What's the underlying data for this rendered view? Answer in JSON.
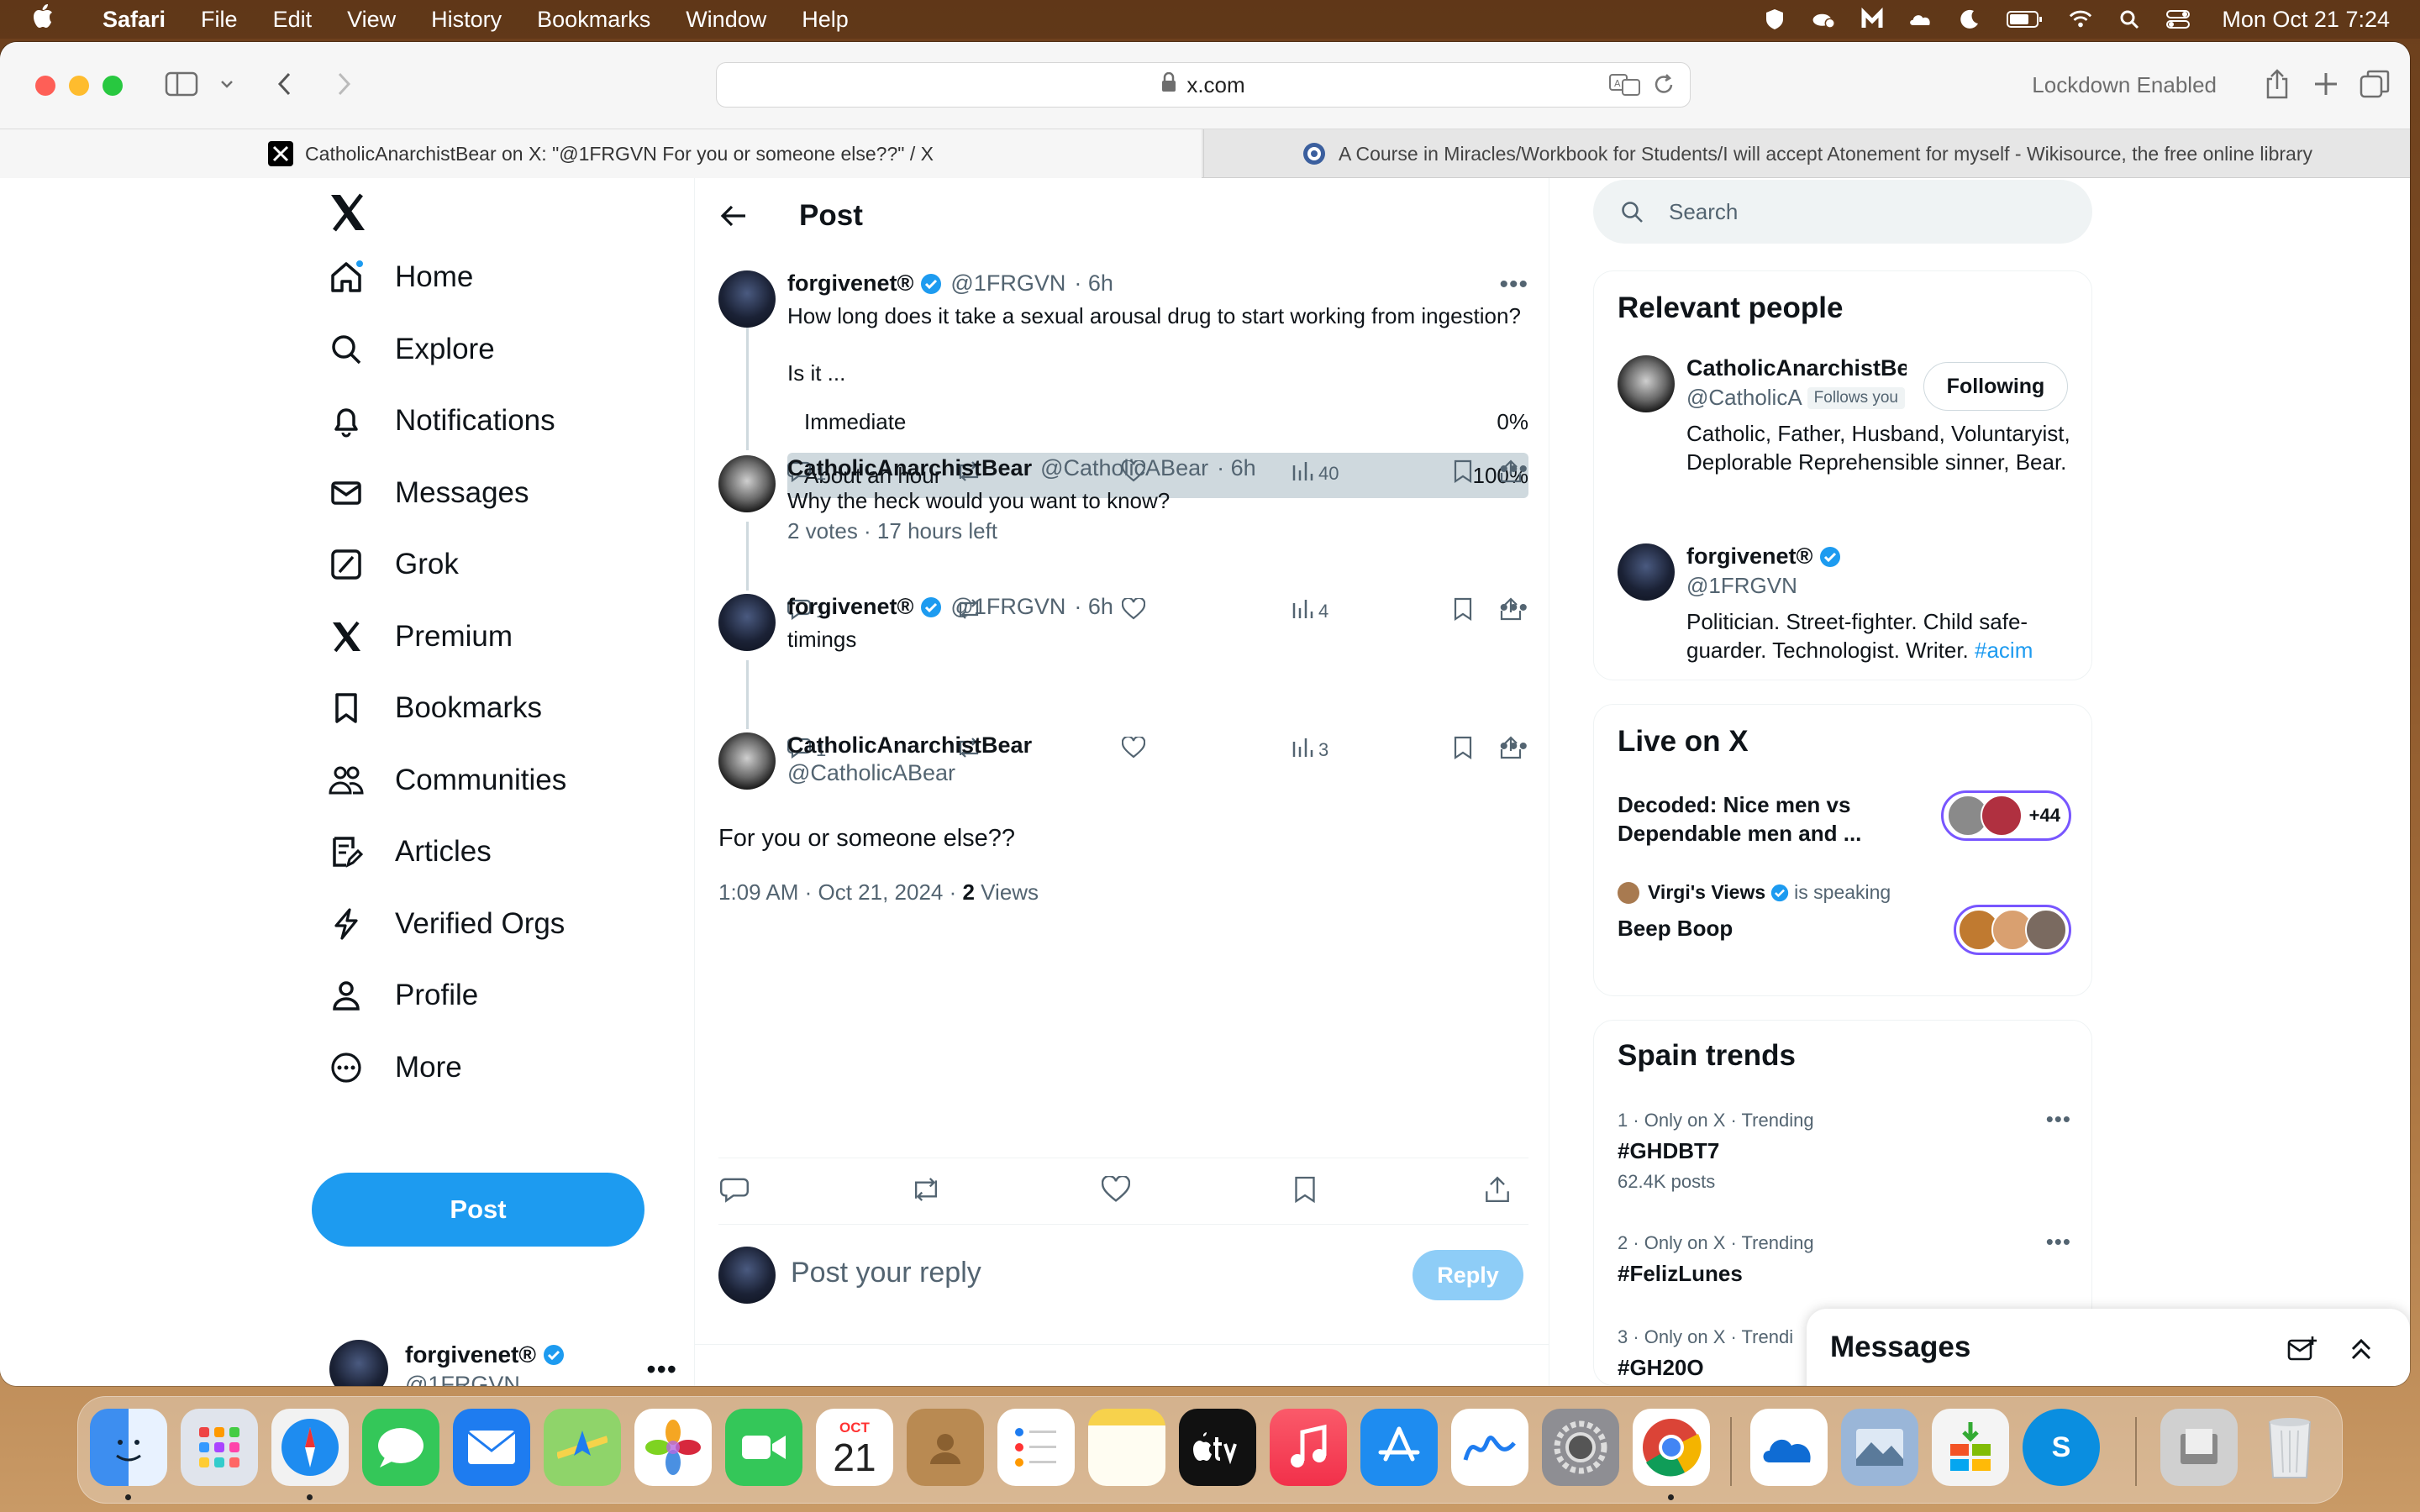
{
  "menubar": {
    "app": "Safari",
    "items": [
      "File",
      "Edit",
      "View",
      "History",
      "Bookmarks",
      "Window",
      "Help"
    ],
    "clock": "Mon Oct 21  7:24",
    "status_icons": [
      "shield-icon",
      "cloud-icon",
      "malwarebytes-icon",
      "cloud-storage-icon",
      "moon-icon",
      "battery-icon",
      "wifi-icon",
      "search-icon",
      "control-center-icon"
    ]
  },
  "browser": {
    "address": "x.com",
    "lockdown": "Lockdown Enabled",
    "tabs": [
      {
        "title": "CatholicAnarchistBear on X: \"@1FRGVN For you or someone else??\" / X",
        "active": true
      },
      {
        "title": "A Course in Miracles/Workbook for Students/I will accept Atonement for myself - Wikisource, the free online library",
        "active": false
      }
    ]
  },
  "nav": {
    "items": [
      {
        "label": "Home",
        "icon": "home-icon"
      },
      {
        "label": "Explore",
        "icon": "search-icon"
      },
      {
        "label": "Notifications",
        "icon": "bell-icon"
      },
      {
        "label": "Messages",
        "icon": "envelope-icon"
      },
      {
        "label": "Grok",
        "icon": "grok-icon"
      },
      {
        "label": "Premium",
        "icon": "x-logo-icon"
      },
      {
        "label": "Bookmarks",
        "icon": "bookmark-icon"
      },
      {
        "label": "Communities",
        "icon": "people-icon"
      },
      {
        "label": "Articles",
        "icon": "article-icon"
      },
      {
        "label": "Verified Orgs",
        "icon": "lightning-icon"
      },
      {
        "label": "Profile",
        "icon": "person-icon"
      },
      {
        "label": "More",
        "icon": "more-circle-icon"
      }
    ],
    "post_button": "Post",
    "account": {
      "name": "forgivenet®",
      "handle": "@1FRGVN"
    }
  },
  "main": {
    "header_title": "Post",
    "tweets": [
      {
        "name": "forgivenet®",
        "handle": "@1FRGVN",
        "time": "· 6h",
        "text": "How long does it take a sexual arousal drug to start working from ingestion?",
        "text2": "Is it ...",
        "poll": [
          {
            "label": "Immediate",
            "percent": "0%",
            "fraction": 0.0
          },
          {
            "label": "About an hour",
            "percent": "100%",
            "fraction": 1.0
          }
        ],
        "poll_meta": "2 votes · 17 hours left",
        "replies": "1",
        "views": "40"
      },
      {
        "name": "CatholicAnarchistBear",
        "handle": "@CatholicABear",
        "time": "· 6h",
        "text": "Why the heck would you want to know?",
        "replies": "1",
        "views": "4"
      },
      {
        "name": "forgivenet®",
        "handle": "@1FRGVN",
        "time": "· 6h",
        "text": "timings",
        "replies": "1",
        "views": "3"
      }
    ],
    "focus": {
      "name": "CatholicAnarchistBear",
      "handle": "@CatholicABear",
      "text": "For you or someone else??",
      "meta": "1:09 AM · Oct 21, 2024 · ",
      "views_count": "2",
      "views_label": " Views"
    },
    "reply_placeholder": "Post your reply",
    "reply_button": "Reply"
  },
  "right": {
    "search_placeholder": "Search",
    "relevant_people": {
      "title": "Relevant people",
      "people": [
        {
          "name": "CatholicAnarchistBe",
          "handle": "@CatholicA",
          "follows_you": "Follows you",
          "button": "Following",
          "bio": "Catholic, Father, Husband, Voluntaryist, Deplorable Reprehensible sinner, Bear."
        },
        {
          "name": "forgivenet®",
          "handle": "@1FRGVN",
          "bio": "Politician. Street-fighter. Child safe-guarder. Technologist. Writer. ",
          "bio_tag": "#acim"
        }
      ]
    },
    "live": {
      "title": "Live on X",
      "items": [
        {
          "title": "Decoded: Nice men vs Dependable men and ...",
          "count": "+44"
        },
        {
          "speaker": "Virgi's Views",
          "status": "is speaking",
          "title": "Beep Boop"
        }
      ]
    },
    "trends": {
      "title": "Spain trends",
      "items": [
        {
          "meta": "1 · Only on X · Trending",
          "name": "#GHDBT7",
          "count": "62.4K posts"
        },
        {
          "meta": "2 · Only on X · Trending",
          "name": "#FelizLunes",
          "count": ""
        },
        {
          "meta": "3 · Only on X · Trendi",
          "name": "#GH20O",
          "count": ""
        }
      ]
    },
    "messages_drawer": "Messages"
  },
  "dock": {
    "calendar_month": "OCT",
    "calendar_day": "21",
    "apps": [
      "finder-icon",
      "launchpad-icon",
      "safari-icon",
      "messages-icon",
      "mail-icon",
      "maps-icon",
      "photos-icon",
      "facetime-icon",
      "calendar-icon",
      "contacts-icon",
      "reminders-icon",
      "notes-icon",
      "appletv-icon",
      "music-icon",
      "appstore-icon",
      "freeform-icon",
      "settings-icon",
      "chrome-icon",
      "onedrive-icon",
      "preview-icon",
      "installer-icon",
      "skype-icon",
      "downloads-icon",
      "trash-icon"
    ]
  }
}
